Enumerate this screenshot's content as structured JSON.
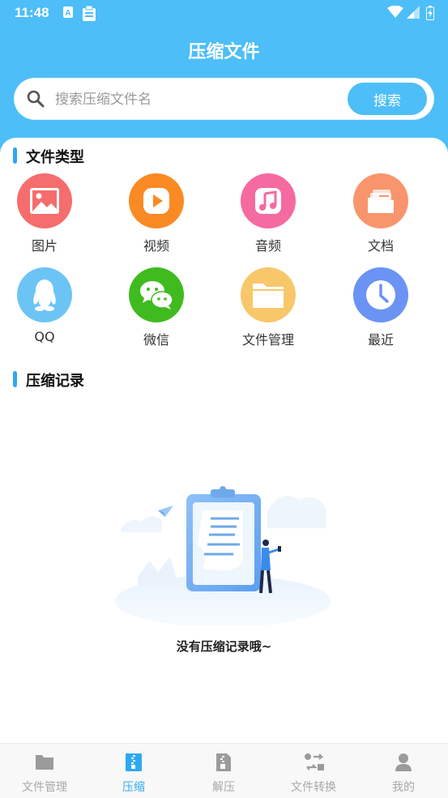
{
  "status_bar": {
    "time": "11:48",
    "left_icons": [
      "text-a-icon",
      "clipboard-icon"
    ],
    "right_icons": [
      "wifi-icon",
      "signal-icon",
      "battery-charging-icon"
    ]
  },
  "header": {
    "title": "压缩文件",
    "background_color": "#4dbef7"
  },
  "search": {
    "placeholder": "搜索压缩文件名",
    "value": "",
    "button_label": "搜索"
  },
  "file_types": {
    "title": "文件类型",
    "items": [
      {
        "label": "图片",
        "icon": "image-icon",
        "color": "#f56d6d"
      },
      {
        "label": "视频",
        "icon": "video-play-icon",
        "color": "#fa8a24"
      },
      {
        "label": "音频",
        "icon": "music-note-icon",
        "color": "#f56aa1"
      },
      {
        "label": "文档",
        "icon": "document-stack-icon",
        "color": "#f9956c"
      },
      {
        "label": "QQ",
        "icon": "qq-penguin-icon",
        "color": "#6cc4f5"
      },
      {
        "label": "微信",
        "icon": "wechat-icon",
        "color": "#3fbb1f"
      },
      {
        "label": "文件管理",
        "icon": "folder-icon",
        "color": "#f8c76a"
      },
      {
        "label": "最近",
        "icon": "clock-icon",
        "color": "#6b93f3"
      }
    ]
  },
  "records": {
    "title": "压缩记录",
    "empty_message": "没有压缩记录哦~"
  },
  "bottom_nav": {
    "active_index": 1,
    "items": [
      {
        "label": "文件管理",
        "icon": "folder-icon"
      },
      {
        "label": "压缩",
        "icon": "zip-file-icon"
      },
      {
        "label": "解压",
        "icon": "unzip-file-icon"
      },
      {
        "label": "文件转换",
        "icon": "convert-arrows-icon"
      },
      {
        "label": "我的",
        "icon": "user-icon"
      }
    ]
  }
}
